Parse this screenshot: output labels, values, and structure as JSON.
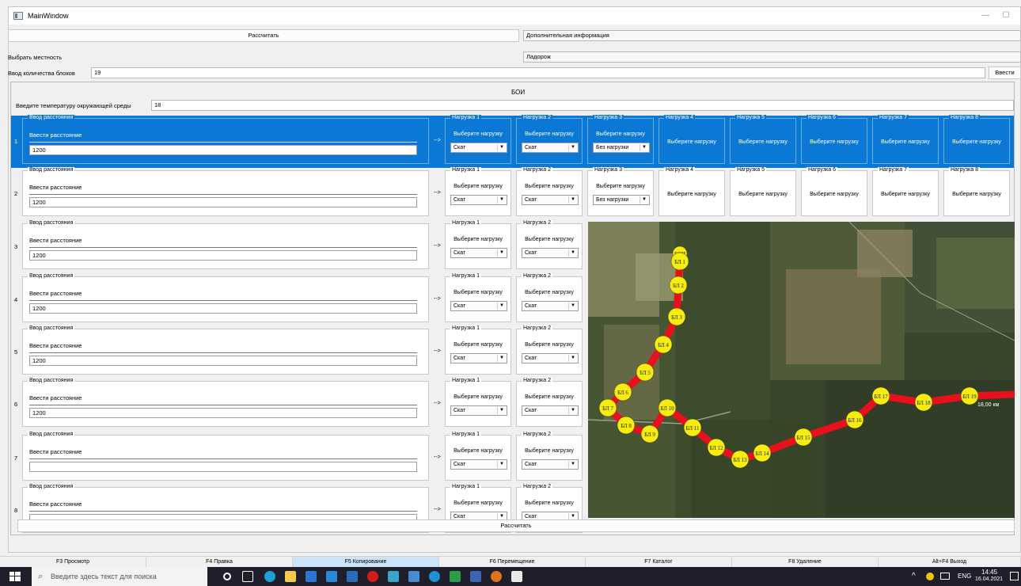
{
  "window": {
    "title": "MainWindow",
    "minimize": "—",
    "maximize": "☐"
  },
  "toolbar": {
    "calc_label": "Рассчитать",
    "info_label": "Дополнительная информация",
    "terrain_label": "Выбрать местность",
    "terrain_value": "Ладорож",
    "block_count_label": "Ввод количества блоков",
    "block_count_value": "19",
    "enter_label": "Ввести"
  },
  "panel": {
    "title": "БОИ",
    "temp_label": "Введите температуру окружающей среды",
    "temp_value": "18",
    "arrow": "-->",
    "group_title": "Ввод расстояния",
    "dist_label": "Ввести расстояние",
    "load_prompt": "Выберите нагрузку",
    "rows": [
      {
        "num": "1",
        "distance": "1200",
        "loads": [
          "Скат",
          "Скат",
          "Без нагрузки"
        ]
      },
      {
        "num": "2",
        "distance": "1200",
        "loads": [
          "Скат",
          "Скат",
          "Без нагрузки"
        ]
      },
      {
        "num": "3",
        "distance": "1200",
        "loads": [
          "Скат",
          "Скат"
        ]
      },
      {
        "num": "4",
        "distance": "1200",
        "loads": [
          "Скат",
          "Скат"
        ]
      },
      {
        "num": "5",
        "distance": "1200",
        "loads": [
          "Скат",
          "Скат"
        ]
      },
      {
        "num": "6",
        "distance": "1200",
        "loads": [
          "Скат",
          "Скат"
        ]
      },
      {
        "num": "7",
        "distance": "",
        "loads": [
          "Скат",
          "Скат"
        ]
      },
      {
        "num": "8",
        "distance": "",
        "loads": [
          "Скат",
          "Скат"
        ]
      }
    ],
    "load_titles": [
      "Нагрузка 1",
      "Нагрузка 2",
      "Нагрузка 3",
      "Нагрузка 4",
      "Нагрузка 5",
      "Нагрузка 6",
      "Нагрузка 7",
      "Нагрузка 8"
    ],
    "bottom_calc": "Рассчитать"
  },
  "map": {
    "markers": [
      "БОИ",
      "БЛ 1",
      "БЛ 2",
      "БЛ 3",
      "БЛ 4",
      "БЛ 5",
      "БЛ 6",
      "БЛ 7",
      "БЛ 8",
      "БЛ 9",
      "БЛ 10",
      "БЛ 11",
      "БЛ 12",
      "БЛ 13",
      "БЛ 14",
      "БЛ 15",
      "БЛ 16",
      "БЛ 17",
      "БЛ 18",
      "БЛ 19"
    ],
    "km_label": "18,00 км",
    "route_color": "#e8101c",
    "marker_color": "#f6ec10"
  },
  "fkeys": [
    "F3 Просмотр",
    "F4 Правка",
    "F5 Копирование",
    "F6 Перемещение",
    "F7 Каталог",
    "F8 Удаление",
    "Alt+F4 Выход"
  ],
  "taskbar": {
    "search_placeholder": "Введите здесь текст для поиска",
    "lang": "ENG",
    "time": "14:45",
    "date": "16.04.2021"
  }
}
